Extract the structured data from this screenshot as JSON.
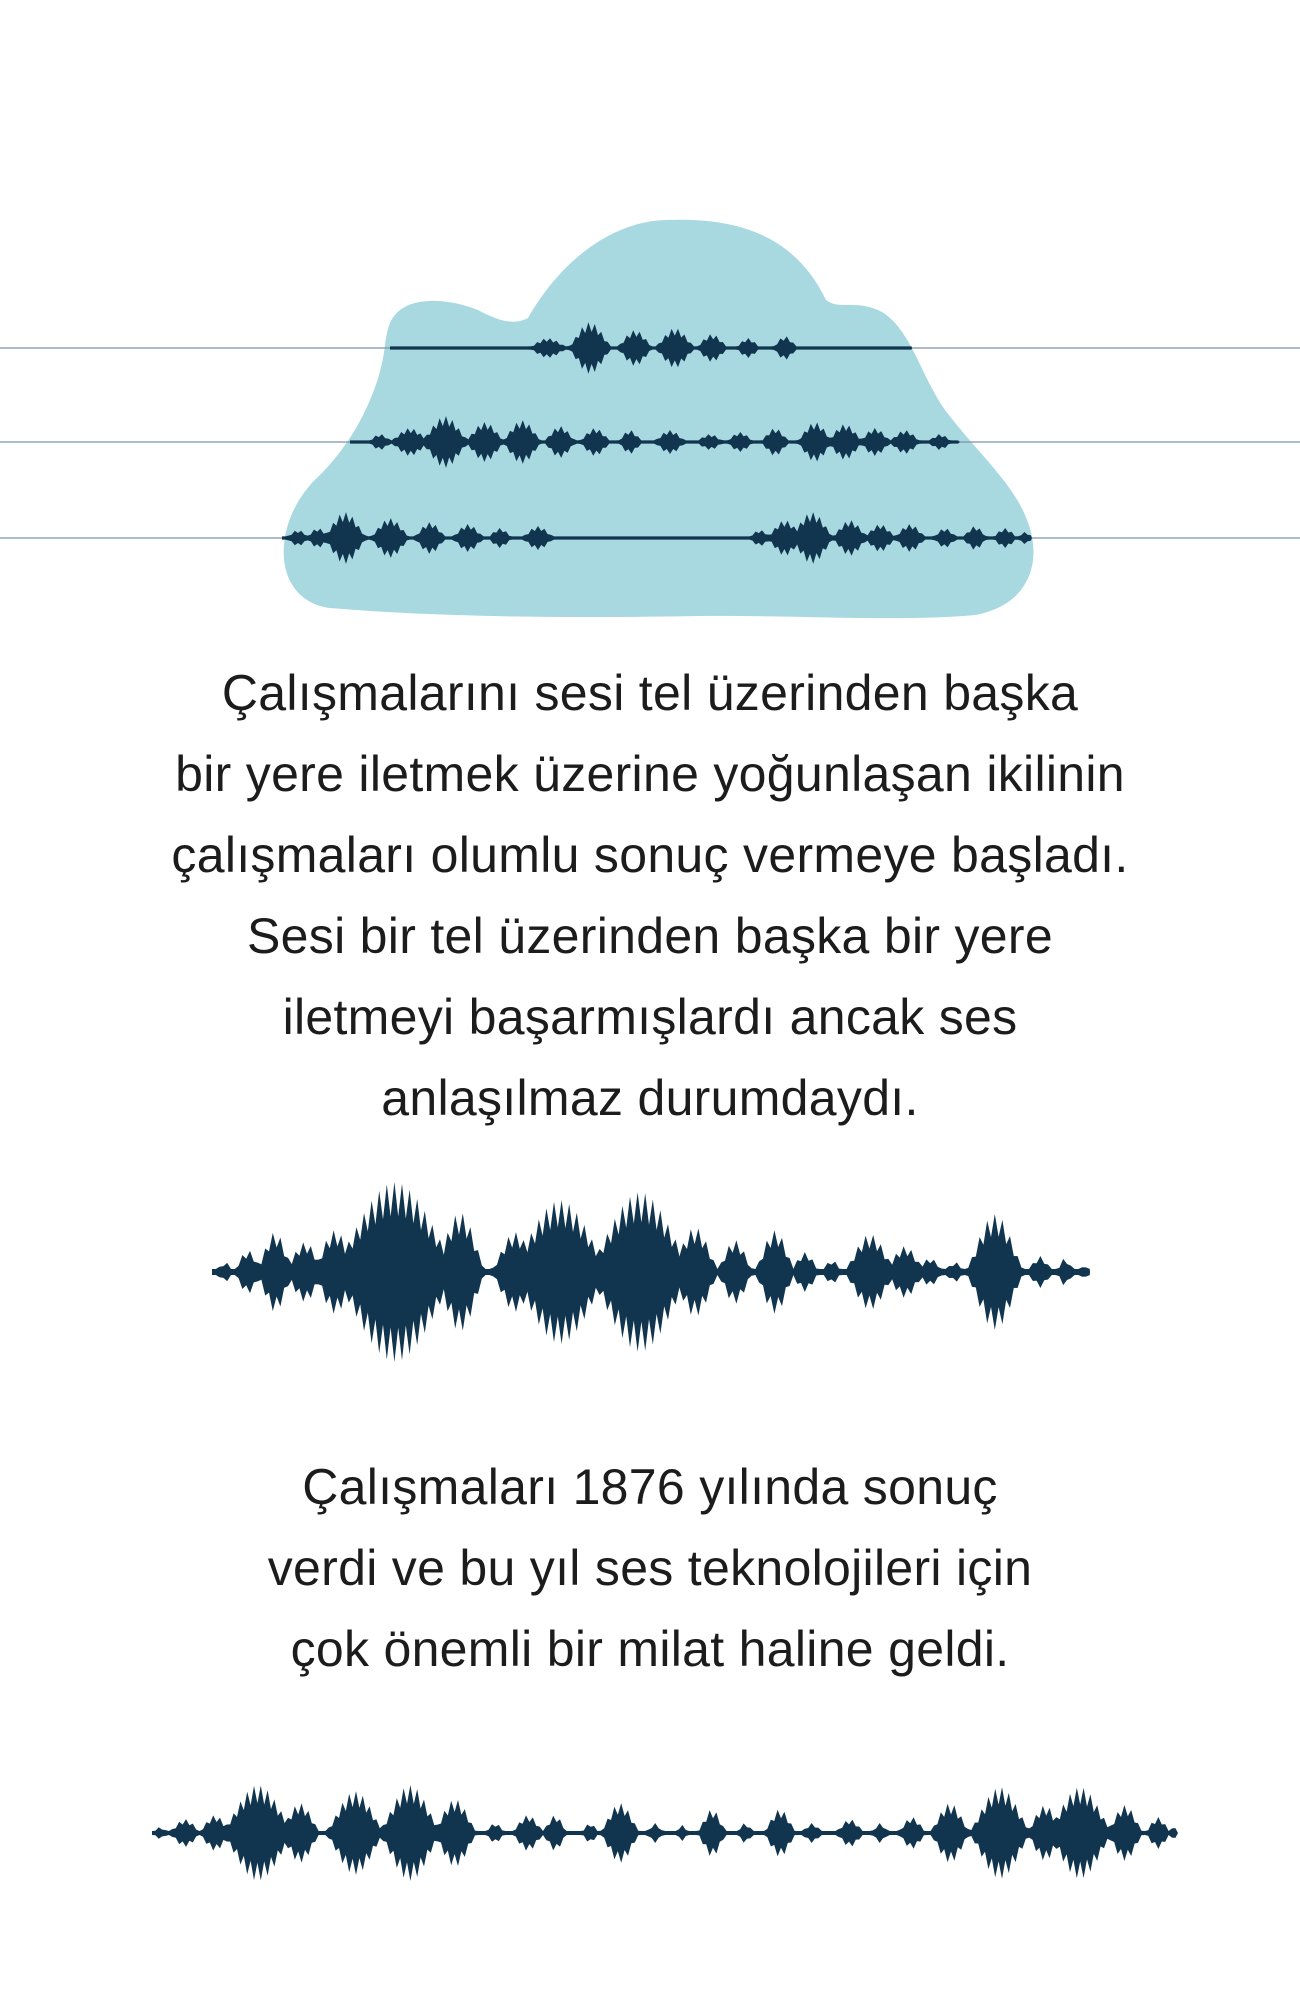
{
  "colors": {
    "cloud": "#a8d8e0",
    "wave": "#12354f",
    "string_line": "#7d92a8",
    "text": "#1c1c1c",
    "background": "#ffffff"
  },
  "illustration": {
    "name": "cloud-with-sound-waves",
    "wire_count": 3
  },
  "paragraph_1": {
    "lines": [
      "Çalışmalarını sesi tel üzerinden başka",
      "bir yere iletmek üzerine yoğunlaşan ikilinin",
      "çalışmaları olumlu sonuç vermeye başladı.",
      "Sesi bir tel üzerinden başka bir yere",
      "iletmeyi başarmışlardı ancak ses",
      "anlaşılmaz durumdaydı."
    ]
  },
  "paragraph_2": {
    "lines": [
      "Çalışmaları 1876 yılında sonuç",
      "verdi ve bu yıl ses teknolojileri için",
      "çok önemli bir milat haline geldi."
    ]
  }
}
